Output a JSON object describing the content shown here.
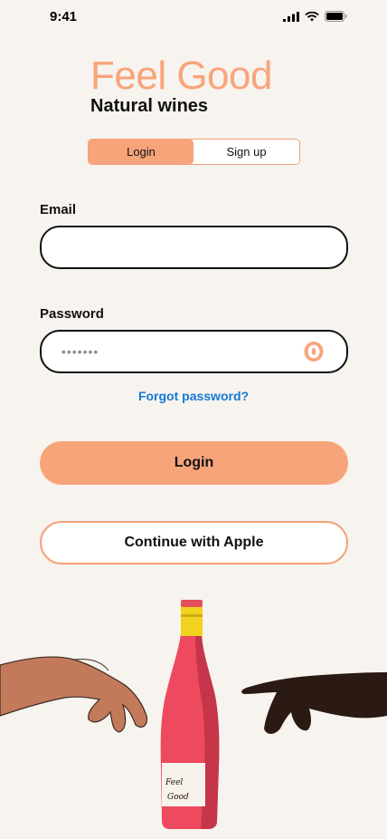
{
  "status_bar": {
    "time": "9:41"
  },
  "brand": {
    "title": "Feel Good",
    "subtitle": "Natural wines"
  },
  "tabs": [
    {
      "label": "Login",
      "active": true
    },
    {
      "label": "Sign up",
      "active": false
    }
  ],
  "form": {
    "email_label": "Email",
    "email_value": "",
    "password_label": "Password",
    "password_mask": "•••••••",
    "forgot_label": "Forgot password?"
  },
  "actions": {
    "login_label": "Login",
    "apple_label": "Continue with Apple"
  },
  "illustration": {
    "bottle_label_line1": "Feel",
    "bottle_label_line2": "Good"
  },
  "colors": {
    "accent": "#F8A47B",
    "link": "#1479D8",
    "background": "#F7F3EE",
    "bottle": "#EE4A5F",
    "cap": "#F2D21E"
  }
}
